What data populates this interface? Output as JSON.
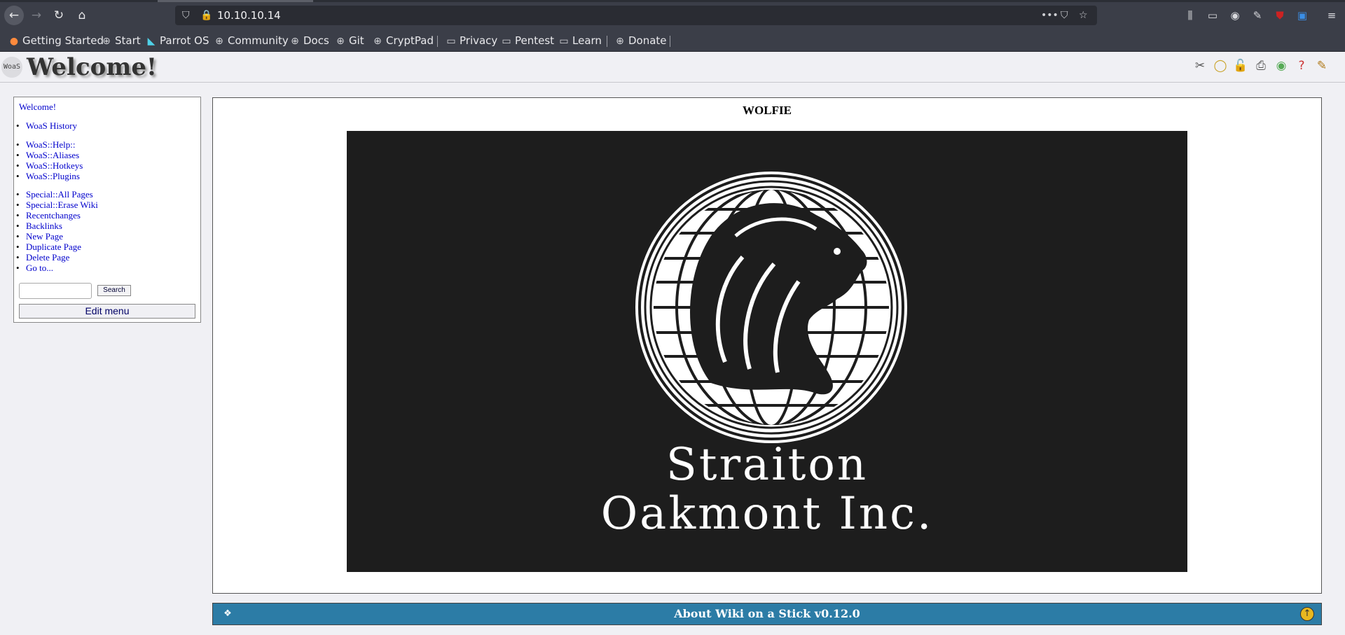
{
  "browser": {
    "url": "10.10.10.14",
    "bookmarks": [
      {
        "label": "Getting Started",
        "icon": "firefox-icon"
      },
      {
        "label": "Start",
        "icon": "globe-icon"
      },
      {
        "label": "Parrot OS",
        "icon": "parrot-icon"
      },
      {
        "label": "Community",
        "icon": "globe-icon"
      },
      {
        "label": "Docs",
        "icon": "globe-icon"
      },
      {
        "label": "Git",
        "icon": "globe-icon"
      },
      {
        "label": "CryptPad",
        "icon": "globe-icon"
      },
      {
        "label": "Privacy",
        "icon": "folder-icon"
      },
      {
        "label": "Pentest",
        "icon": "folder-icon"
      },
      {
        "label": "Learn",
        "icon": "folder-icon"
      },
      {
        "label": "Donate",
        "icon": "globe-icon"
      }
    ]
  },
  "wiki": {
    "logo_text": "WoaS",
    "page_title": "Welcome!",
    "menu": {
      "welcome": "Welcome!",
      "group1": [
        "WoaS History"
      ],
      "group2": [
        "WoaS::Help::",
        "WoaS::Aliases",
        "WoaS::Hotkeys",
        "WoaS::Plugins"
      ],
      "group3": [
        "Special::All Pages",
        "Special::Erase Wiki",
        "Recentchanges",
        "Backlinks",
        "New Page",
        "Duplicate Page",
        "Delete Page",
        "Go to..."
      ],
      "search_label": "Search",
      "edit_menu_label": "Edit menu"
    },
    "content": {
      "heading": "WOLFIE",
      "logo_line1": "Straiton",
      "logo_line2": "Oakmont Inc."
    },
    "footer": {
      "text": "About Wiki on a Stick v0.12.0"
    }
  },
  "colors": {
    "link": "#0000cc",
    "footer_bg": "#2c7ca6",
    "chrome_bg": "#3b3e48"
  }
}
